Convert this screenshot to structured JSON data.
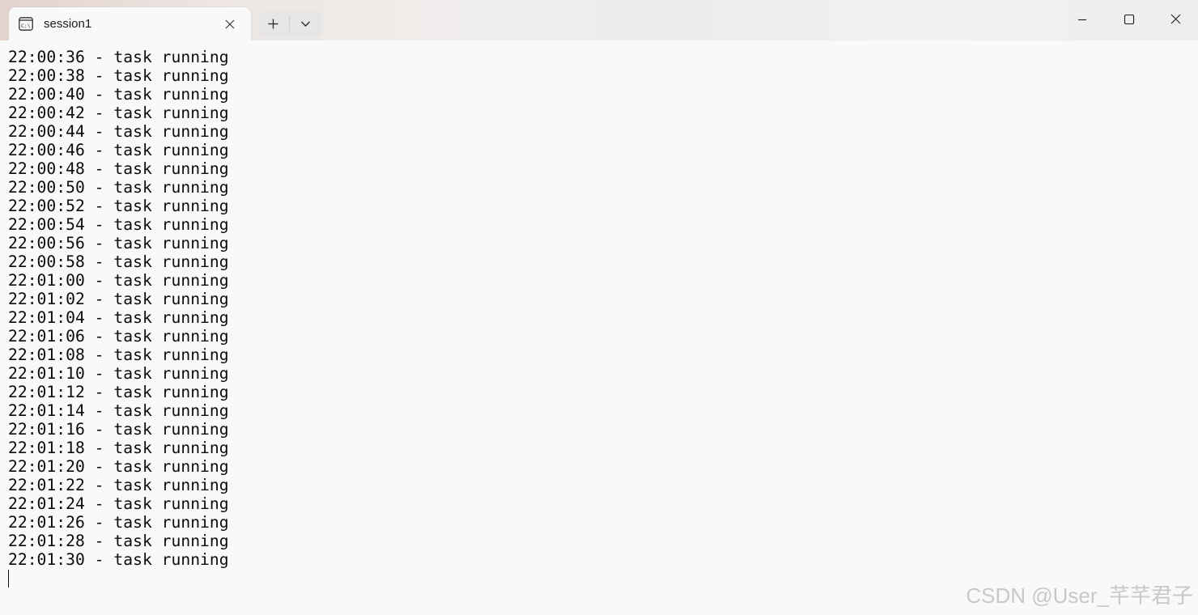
{
  "tab": {
    "title": "session1",
    "icon": "terminal-icon"
  },
  "titlebar": {
    "new_tab_icon": "plus-icon",
    "dropdown_icon": "chevron-down-icon",
    "minimize_icon": "minimize-icon",
    "maximize_icon": "maximize-icon",
    "close_icon": "close-icon"
  },
  "terminal": {
    "lines": [
      "22:00:36 - task running",
      "22:00:38 - task running",
      "22:00:40 - task running",
      "22:00:42 - task running",
      "22:00:44 - task running",
      "22:00:46 - task running",
      "22:00:48 - task running",
      "22:00:50 - task running",
      "22:00:52 - task running",
      "22:00:54 - task running",
      "22:00:56 - task running",
      "22:00:58 - task running",
      "22:01:00 - task running",
      "22:01:02 - task running",
      "22:01:04 - task running",
      "22:01:06 - task running",
      "22:01:08 - task running",
      "22:01:10 - task running",
      "22:01:12 - task running",
      "22:01:14 - task running",
      "22:01:16 - task running",
      "22:01:18 - task running",
      "22:01:20 - task running",
      "22:01:22 - task running",
      "22:01:24 - task running",
      "22:01:26 - task running",
      "22:01:28 - task running",
      "22:01:30 - task running"
    ],
    "text_color": "#0c0c0c",
    "background_color": "#f9f9f9"
  },
  "watermark": {
    "text": "CSDN @User_芊芊君子"
  }
}
